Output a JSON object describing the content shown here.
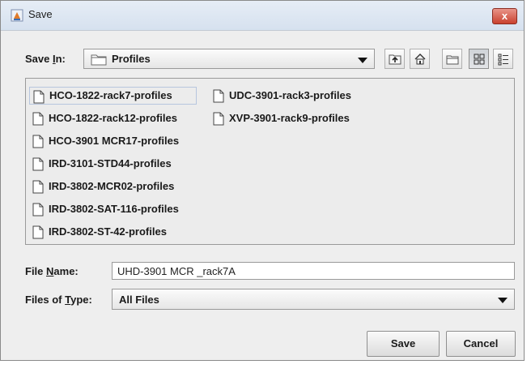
{
  "window": {
    "title": "Save",
    "close_label": "x"
  },
  "save_in": {
    "label_prefix": "Save ",
    "label_mnemonic": "I",
    "label_suffix": "n:",
    "selected": "Profiles"
  },
  "toolbar": {
    "buttons": [
      "up-one-level",
      "home",
      "new-folder",
      "list-view",
      "details-view"
    ]
  },
  "files": [
    "HCO-1822-rack7-profiles",
    "HCO-1822-rack12-profiles",
    "HCO-3901 MCR17-profiles",
    "IRD-3101-STD44-profiles",
    "IRD-3802-MCR02-profiles",
    "IRD-3802-SAT-116-profiles",
    "IRD-3802-ST-42-profiles",
    "UDC-3901-rack3-profiles",
    "XVP-3901-rack9-profiles"
  ],
  "file_name": {
    "label_prefix": "File ",
    "label_mnemonic": "N",
    "label_suffix": "ame:",
    "value": "UHD-3901 MCR _rack7A"
  },
  "file_type": {
    "label_prefix": "Files of ",
    "label_mnemonic": "T",
    "label_suffix": "ype:",
    "selected": "All Files"
  },
  "buttons": {
    "save": "Save",
    "cancel": "Cancel"
  },
  "colors": {
    "titlebar": "#dbe4f0",
    "close": "#c9412f",
    "folder": "#f2d27a",
    "selection_border": "#b7c6de"
  }
}
